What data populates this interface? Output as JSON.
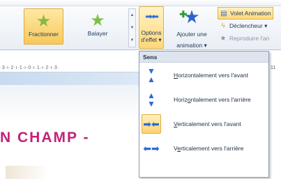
{
  "ribbon": {
    "fractionner_label": "Fractionner",
    "balayer_label": "Balayer",
    "options_label_1": "Options",
    "options_label_2": "d'effet",
    "ajouter_label_1": "Ajouter une",
    "ajouter_label_2": "animation",
    "side_commands": [
      {
        "label": "Volet Animation",
        "icon": "animation-pane-icon"
      },
      {
        "label": "Déclencheur",
        "icon": "lightning-icon"
      },
      {
        "label": "Reproduire l'an",
        "icon": "animation-painter-icon"
      }
    ]
  },
  "ruler": {
    "text": "·3·ı·2·ı·1·ı·0·ı·1·ı·2·ı·3·",
    "right_text": "11"
  },
  "slide": {
    "title_visible": "N  CHAMP  -",
    "title_color": "#c0227a"
  },
  "dropdown": {
    "header": "Sens",
    "items": [
      {
        "label": "Horizontalement vers l'avant",
        "mnemonic_index": 0,
        "icon": "arrow-down-icon",
        "selected": false
      },
      {
        "label": "Horizontalement vers l'arrière",
        "mnemonic_index": 5,
        "icon": "arrow-up-icon",
        "selected": false
      },
      {
        "label": "Verticalement vers l'avant",
        "mnemonic_index": 0,
        "icon": "arrows-inward-icon",
        "selected": true
      },
      {
        "label": "Verticalement vers l'arrière",
        "mnemonic_index": 1,
        "icon": "arrows-outward-icon",
        "selected": false
      }
    ]
  },
  "colors": {
    "accent": "#2b6bd0",
    "highlight": "#ffd270",
    "title": "#c0227a"
  }
}
